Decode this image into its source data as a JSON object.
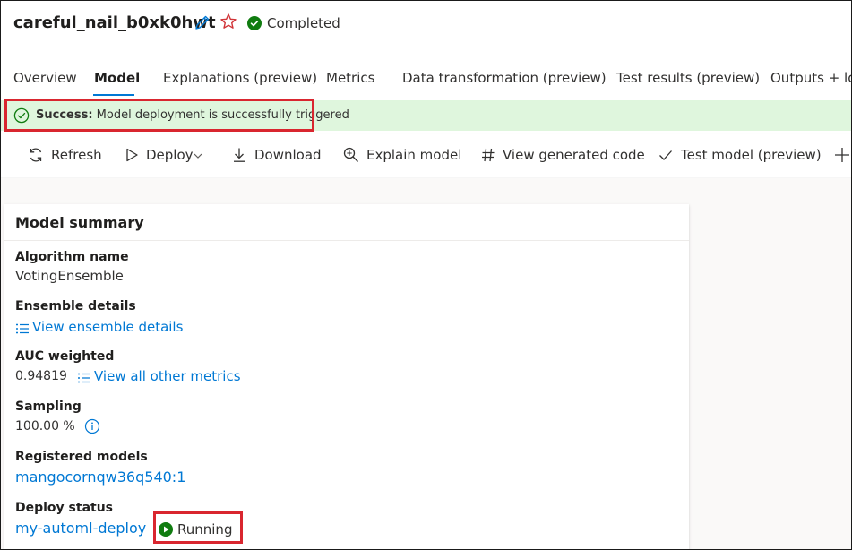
{
  "header": {
    "title": "careful_nail_b0xk0hwt",
    "status_text": "Completed"
  },
  "tabs": [
    {
      "label": "Overview"
    },
    {
      "label": "Model"
    },
    {
      "label": "Explanations (preview)"
    },
    {
      "label": "Metrics"
    },
    {
      "label": "Data transformation (preview)"
    },
    {
      "label": "Test results (preview)"
    },
    {
      "label": "Outputs + log"
    }
  ],
  "banner": {
    "strong": "Success:",
    "message": "Model deployment is successfully triggered"
  },
  "toolbar": {
    "refresh": "Refresh",
    "deploy": "Deploy",
    "download": "Download",
    "explain": "Explain model",
    "view_code": "View generated code",
    "test_model": "Test model (preview)"
  },
  "summary": {
    "title": "Model summary",
    "algorithm_label": "Algorithm name",
    "algorithm_value": "VotingEnsemble",
    "ensemble_label": "Ensemble details",
    "ensemble_link": "View ensemble details",
    "auc_label": "AUC weighted",
    "auc_value": "0.94819",
    "metrics_link": "View all other metrics",
    "sampling_label": "Sampling",
    "sampling_value": "100.00 %",
    "registered_label": "Registered models",
    "registered_link": "mangocornqw36q540:1",
    "deploy_label": "Deploy status",
    "deploy_link": "my-automl-deploy",
    "deploy_state": "Running"
  },
  "colors": {
    "accent": "#0078d4",
    "success_green": "#107c10",
    "banner_bg": "#dff6dd",
    "highlight_red": "#d9262f"
  }
}
